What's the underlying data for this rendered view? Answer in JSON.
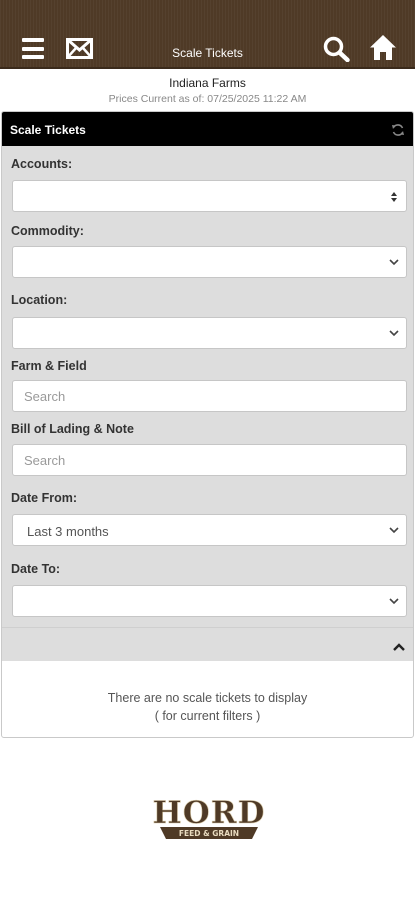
{
  "header": {
    "title": "Scale Tickets",
    "icons": [
      "menu-icon",
      "mail-icon",
      "search-icon",
      "home-icon"
    ],
    "background": "#4f3a26"
  },
  "account": {
    "farm_name": "Indiana Farms",
    "prices_current": "Prices Current as of: 07/25/2025 11:22 AM"
  },
  "panel": {
    "title": "Scale Tickets",
    "filters": {
      "accounts": {
        "label": "Accounts:",
        "value": ""
      },
      "commodity": {
        "label": "Commodity:",
        "value": ""
      },
      "location": {
        "label": "Location:",
        "value": ""
      },
      "farm_field": {
        "label": "Farm & Field",
        "placeholder": "Search"
      },
      "bill_of_lading": {
        "label": "Bill of Lading & Note",
        "placeholder": "Search"
      },
      "date_from": {
        "label": "Date From:",
        "value": "Last 3 months"
      },
      "date_to": {
        "label": "Date To:",
        "value": ""
      }
    },
    "empty_message": "There are no scale tickets to display",
    "empty_sub": "( for current filters )"
  },
  "logo": {
    "name": "HORD",
    "tagline": "FEED & GRAIN"
  }
}
